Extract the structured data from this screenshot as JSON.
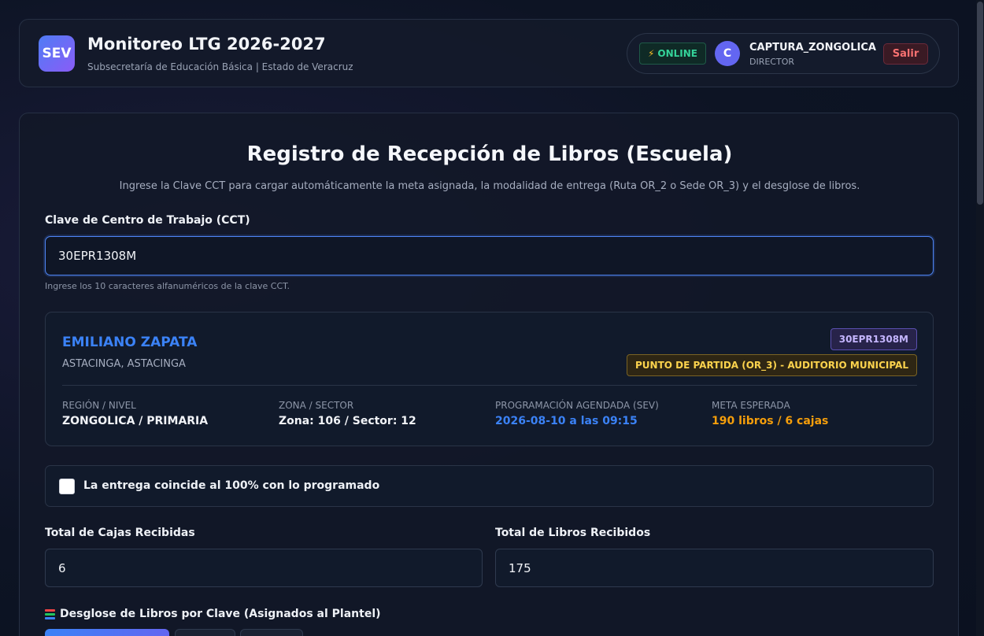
{
  "header": {
    "logo_text": "SEV",
    "title": "Monitoreo LTG 2026-2027",
    "subtitle": "Subsecretaría de Educación Básica | Estado de Veracruz",
    "status_badge": "ONLINE",
    "status_icon": "lightning-bolt-icon",
    "avatar_initial": "C",
    "user_name": "CAPTURA_ZONGOLICA",
    "user_role": "DIRECTOR",
    "logout_label": "Salir"
  },
  "form": {
    "title": "Registro de Recepción de Libros (Escuela)",
    "description": "Ingrese la Clave CCT para cargar automáticamente la meta asignada, la modalidad de entrega (Ruta OR_2 o Sede OR_3) y el desglose de libros.",
    "cct_label": "Clave de Centro de Trabajo (CCT)",
    "cct_value": "30EPR1308M",
    "cct_hint": "Ingrese los 10 caracteres alfanuméricos de la clave CCT.",
    "school": {
      "name": "EMILIANO ZAPATA",
      "location": "ASTACINGA, ASTACINGA",
      "cct_badge": "30EPR1308M",
      "mode_badge": "PUNTO DE PARTIDA (OR_3) - AUDITORIO MUNICIPAL",
      "region_label": "REGIÓN / NIVEL",
      "region_value": "ZONGOLICA / PRIMARIA",
      "zone_label": "ZONA / SECTOR",
      "zone_value": "Zona: 106 / Sector: 12",
      "schedule_label": "PROGRAMACIÓN AGENDADA (SEV)",
      "schedule_value": "2026-08-10 a las 09:15",
      "goal_label": "META ESPERADA",
      "goal_value": "190 libros / 6 cajas"
    },
    "match_checkbox_label": "La entrega coincide al 100% con lo programado",
    "boxes_label": "Total de Cajas Recibidas",
    "boxes_value": "6",
    "books_label": "Total de Libros Recibidos",
    "books_value": "175",
    "breakdown_title": "Desglose de Libros por Clave (Asignados al Plantel)",
    "breakdown_icon": "books-icon"
  },
  "colors": {
    "accent": "#3b82f6",
    "online": "#34d399",
    "warning": "#fcd34d",
    "danger": "#f87171",
    "goal": "#f59e0b"
  }
}
